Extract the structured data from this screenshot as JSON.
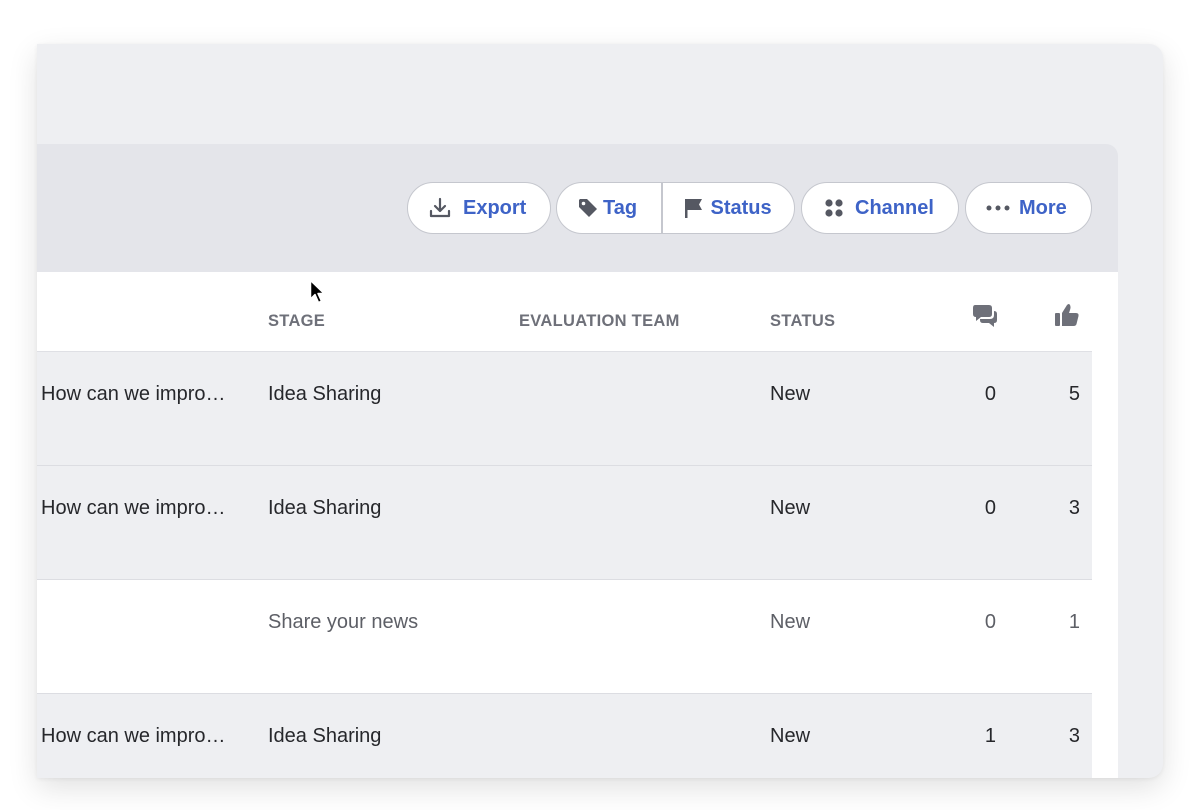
{
  "toolbar": {
    "export_label": "Export",
    "tag_label": "Tag",
    "status_label": "Status",
    "channel_label": "Channel",
    "more_label": "More",
    "icons": [
      "download-icon",
      "tag-icon",
      "flag-icon",
      "dots-grid-icon",
      "ellipsis-icon"
    ],
    "accent_color": "#3e63c7"
  },
  "table": {
    "headers": {
      "stage": "STAGE",
      "evaluation_team": "EVALUATION TEAM",
      "status": "STATUS",
      "comments_icon": "comments-icon",
      "likes_icon": "thumbs-up-icon"
    },
    "rows": [
      {
        "title": "How can we impro…",
        "stage": "Idea Sharing",
        "evaluation_team": "",
        "status": "New",
        "comments": "0",
        "likes": "5"
      },
      {
        "title": "How can we impro…",
        "stage": "Idea Sharing",
        "evaluation_team": "",
        "status": "New",
        "comments": "0",
        "likes": "3"
      },
      {
        "title": "",
        "stage": "Share your news",
        "evaluation_team": "",
        "status": "New",
        "comments": "0",
        "likes": "1"
      },
      {
        "title": "How can we impro…",
        "stage": "Idea Sharing",
        "evaluation_team": "",
        "status": "New",
        "comments": "1",
        "likes": "3"
      }
    ]
  }
}
